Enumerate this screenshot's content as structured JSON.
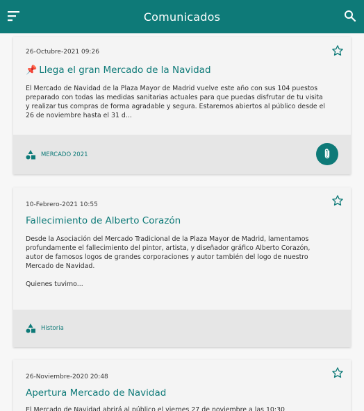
{
  "header": {
    "title": "Comunicados",
    "menu_icon": "menu-icon",
    "search_icon": "search-icon"
  },
  "colors": {
    "primary": "#0e7a78",
    "card": "#f4f4f4",
    "footer": "#e6e6e6"
  },
  "posts": [
    {
      "date": "26-Octubre-2021 09:26",
      "pinned": true,
      "pin_icon": "pushpin-icon",
      "title": "Llega el gran Mercado de la Navidad",
      "text": "El Mercado de Navidad de la Plaza Mayor de Madrid vuelve este año con sus 104 puestos preparado con todas las medidas sanitarias actuales para que puedas disfrutar de tu visita y realizar tus compras de forma agradable y segura. Estaremos abiertos al público desde el 26 de noviembre hasta el 31 d...",
      "category": "MERCADO 2021",
      "has_attachment": true
    },
    {
      "date": "10-Febrero-2021 10:55",
      "pinned": false,
      "title": "Fallecimiento de Alberto Corazón",
      "text": "Desde la Asociación del Mercado Tradicional de la Plaza Mayor de Madrid, lamentamos profundamente el fallecimiento del pintor, artista, y diseñador gráfico Alberto Corazón, autor de famosos logos de grandes corporaciones y autor también del logo de nuestro Mercado de Navidad.",
      "text2": "Quienes tuvimo...",
      "category": "Historia",
      "has_attachment": false
    },
    {
      "date": "26-Noviembre-2020 20:48",
      "pinned": false,
      "title": "Apertura Mercado de Navidad",
      "text": "El Mercado de Navidad abrirá al público el viernes 27 de noviembre a las 10:30",
      "category": "",
      "has_attachment": false
    }
  ]
}
